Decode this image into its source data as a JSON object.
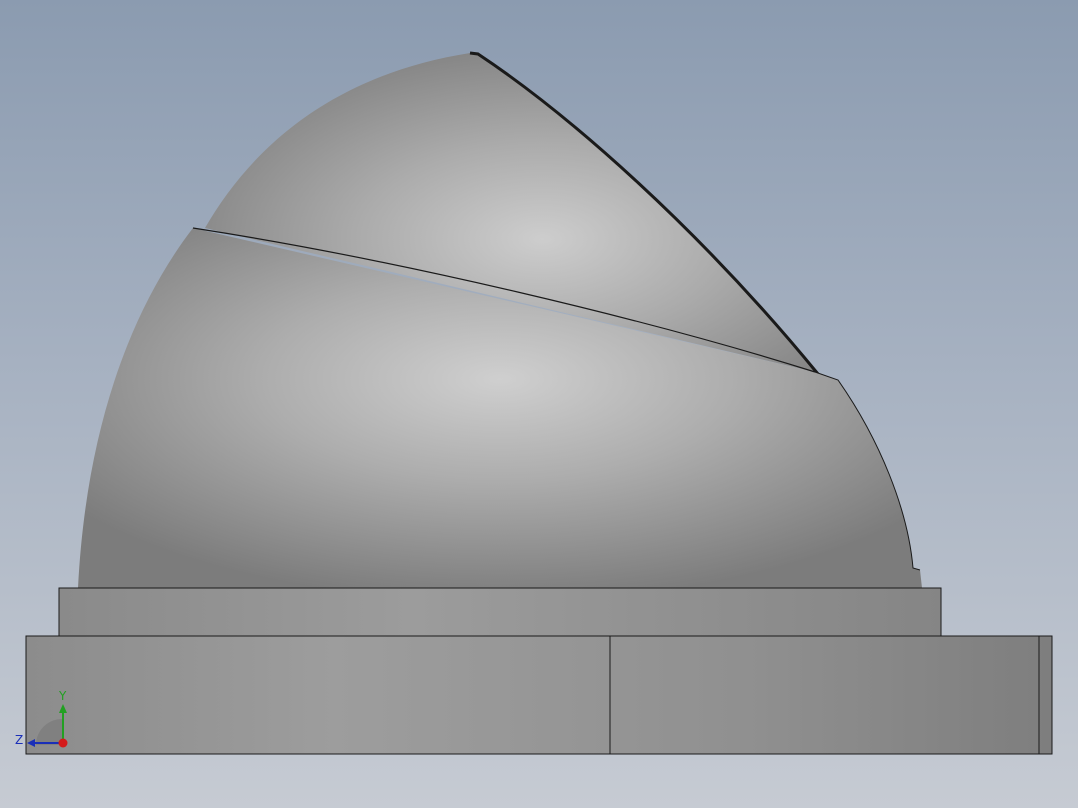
{
  "view": {
    "background_top": "#8b9bb0",
    "background_bottom": "#c6cbd3",
    "model_color": "#a8a8a8",
    "edge_color": "#1a1a1a"
  },
  "triad": {
    "y_label": "Y",
    "z_label": "Z",
    "y_color": "#22a022",
    "z_color": "#1a2fb8",
    "x_color": "#d41a1a"
  }
}
